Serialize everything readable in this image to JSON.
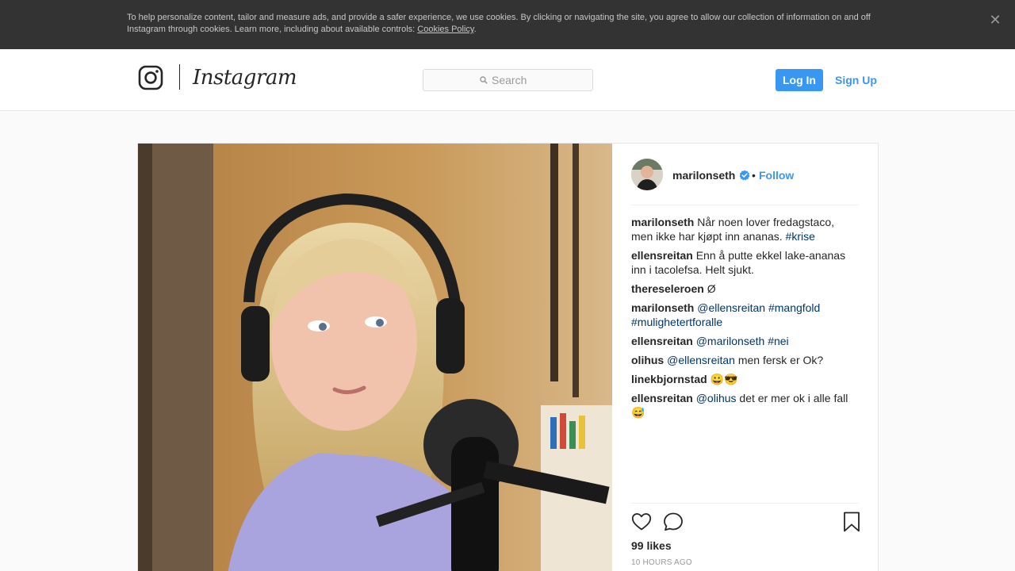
{
  "cookie_banner": {
    "text": "To help personalize content, tailor and measure ads, and provide a safer experience, we use cookies. By clicking or navigating the site, you agree to allow our collection of information on and off Instagram through cookies. Learn more, including about available controls: ",
    "link": "Cookies Policy",
    "suffix": ".",
    "close_glyph": "✕"
  },
  "header": {
    "logo_icon": "instagram-camera-icon",
    "wordmark": "Instagram",
    "search_placeholder": "Search",
    "login_label": "Log In",
    "signup_label": "Sign Up"
  },
  "post": {
    "owner": {
      "username": "marilonseth",
      "verified": true,
      "dot": "•",
      "follow_label": "Follow"
    },
    "comments": [
      {
        "user": "marilonseth",
        "parts": [
          {
            "t": "Når noen lover fredagstaco, men ikke har kjøpt inn ananas. "
          },
          {
            "tag": "#krise"
          }
        ]
      },
      {
        "user": "ellensreitan",
        "parts": [
          {
            "t": "Enn å putte ekkel lake-ananas inn i tacolefsa. Helt sjukt."
          }
        ]
      },
      {
        "user": "thereseleroen",
        "parts": [
          {
            "t": "Ø"
          }
        ]
      },
      {
        "user": "marilonseth",
        "parts": [
          {
            "tag": "@ellensreitan"
          },
          {
            "t": " "
          },
          {
            "tag": "#mangfold"
          },
          {
            "t": " "
          },
          {
            "tag": "#mulighetertforalle"
          }
        ]
      },
      {
        "user": "ellensreitan",
        "parts": [
          {
            "tag": "@marilonseth"
          },
          {
            "t": " "
          },
          {
            "tag": "#nei"
          }
        ]
      },
      {
        "user": "olihus",
        "parts": [
          {
            "tag": "@ellensreitan"
          },
          {
            "t": " men fersk er Ok?"
          }
        ]
      },
      {
        "user": "linekbjornstad",
        "parts": [
          {
            "t": "😀😎"
          }
        ]
      },
      {
        "user": "ellensreitan",
        "parts": [
          {
            "tag": "@olihus"
          },
          {
            "t": " det er mer ok i alle fall 😅"
          }
        ]
      }
    ],
    "likes": "99 likes",
    "time": "10 HOURS AGO",
    "icons": {
      "like": "heart-icon",
      "comment": "comment-bubble-icon",
      "save": "bookmark-icon",
      "verified": "verified-badge-icon"
    },
    "colors": {
      "accent": "#3897f0",
      "hashtag": "#003569"
    }
  }
}
